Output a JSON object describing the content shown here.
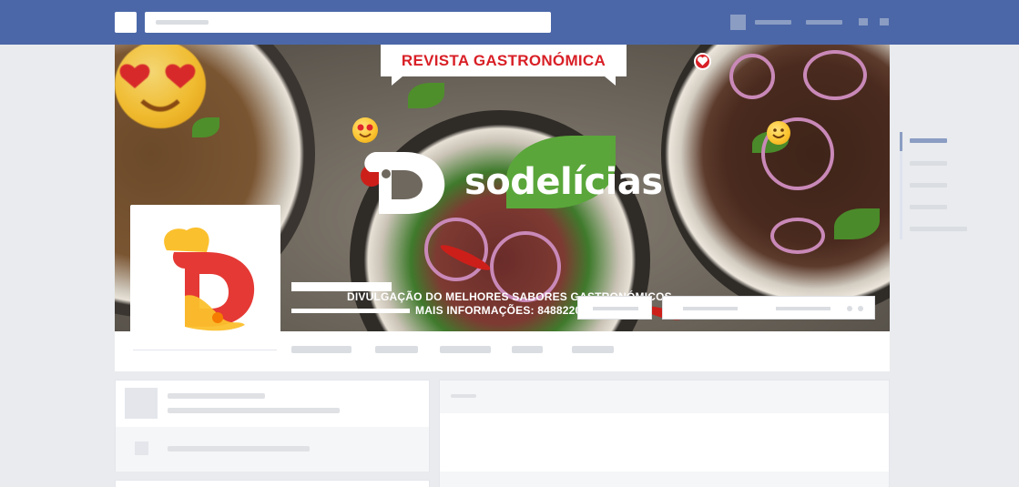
{
  "cover": {
    "banner_title": "REVISTA GASTRONÓMICA",
    "brand_name": "sodelícias",
    "tagline_line1": "DIVULGAÇÃO DO MELHORES SABORES GASTRONÓMICOS.",
    "tagline_line2": "MAIS INFORMAÇÕES: 84882205"
  },
  "colors": {
    "topbar": "#4b67a8",
    "page_bg": "#e9ebee",
    "brand_red": "#d81f26",
    "brand_yellow": "#fbc02d"
  },
  "icons": [
    "logo-box",
    "heart-icon",
    "emoji-heart-eyes",
    "emoji-smile",
    "brand-logo"
  ]
}
